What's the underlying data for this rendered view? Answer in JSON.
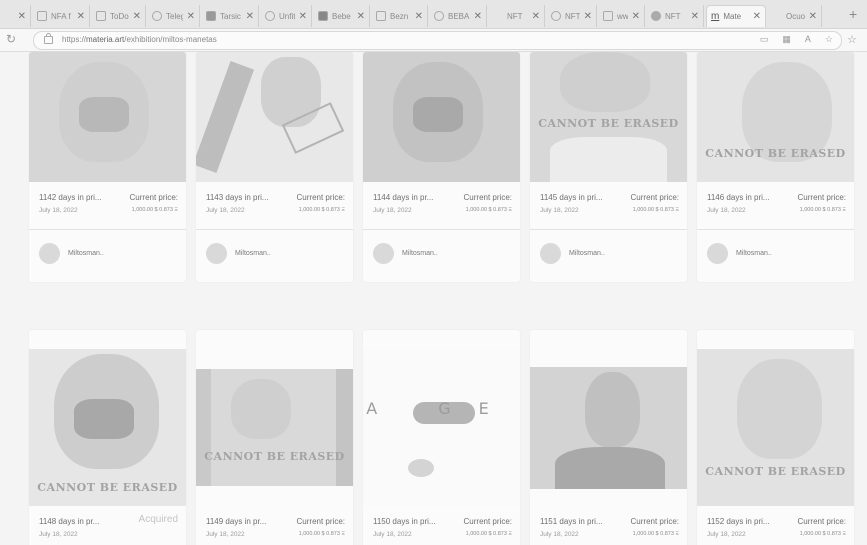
{
  "browser": {
    "tabs": [
      {
        "title": "",
        "active": false
      },
      {
        "title": "NFA f",
        "active": false
      },
      {
        "title": "ToDo",
        "active": false
      },
      {
        "title": "Teleg",
        "active": false
      },
      {
        "title": "Tarsic",
        "active": false
      },
      {
        "title": "Unfit",
        "active": false
      },
      {
        "title": "Bebe",
        "active": false
      },
      {
        "title": "Bezn",
        "active": false
      },
      {
        "title": "BEBA",
        "active": false
      },
      {
        "title": "NFT",
        "active": false
      },
      {
        "title": "NFT",
        "active": false
      },
      {
        "title": "www",
        "active": false
      },
      {
        "title": "NFT",
        "active": false
      },
      {
        "title": "Mate",
        "active": true
      },
      {
        "title": "Ocuo",
        "active": false
      }
    ],
    "new_tab": "+",
    "url_prefix": "https://",
    "url_host": "materia.art",
    "url_path": "/exhibition/miltos-manetas"
  },
  "cards": [
    {
      "days": "1142 days in pri...",
      "date": "July 18, 2022",
      "price_label": "Current price:",
      "price_value": "1,000.00 $ 0.873 Ξ",
      "owner": "Miltosman..",
      "caption": ""
    },
    {
      "days": "1143 days in pri...",
      "date": "July 18, 2022",
      "price_label": "Current price:",
      "price_value": "1,000.00 $ 0.873 Ξ",
      "owner": "Miltosman..",
      "caption": ""
    },
    {
      "days": "1144 days in pr...",
      "date": "July 18, 2022",
      "price_label": "Current price:",
      "price_value": "1,000.00 $ 0.873 Ξ",
      "owner": "Miltosman..",
      "caption": ""
    },
    {
      "days": "1145 days in pri...",
      "date": "July 18, 2022",
      "price_label": "Current price:",
      "price_value": "1,000.00 $ 0.873 Ξ",
      "owner": "Miltosman..",
      "caption": "CANNOT BE ERASED"
    },
    {
      "days": "1146 days in pri...",
      "date": "July 18, 2022",
      "price_label": "Current price:",
      "price_value": "1,000.00 $ 0.873 Ξ",
      "owner": "Miltosman..",
      "caption": "CANNOT BE ERASED"
    },
    {
      "days": "1148 days in pr...",
      "date": "July 18, 2022",
      "status": "Acquired",
      "caption": "CANNOT BE ERASED"
    },
    {
      "days": "1149 days in pr...",
      "date": "July 18, 2022",
      "price_label": "Current price:",
      "price_value": "1,000.00 $ 0.873 Ξ",
      "caption": "CANNOT BE ERASED"
    },
    {
      "days": "1150 days in pri...",
      "date": "July 18, 2022",
      "price_label": "Current price:",
      "price_value": "1,000.00 $ 0.873 Ξ",
      "caption": "A GE"
    },
    {
      "days": "1151 days in pri...",
      "date": "July 18, 2022",
      "price_label": "Current price:",
      "price_value": "1,000.00 $ 0.873 Ξ",
      "caption": ""
    },
    {
      "days": "1152 days in pri...",
      "date": "July 18, 2022",
      "price_label": "Current price:",
      "price_value": "1,000.00 $ 0.873 Ξ",
      "caption": "CANNOT BE ERASED"
    }
  ]
}
